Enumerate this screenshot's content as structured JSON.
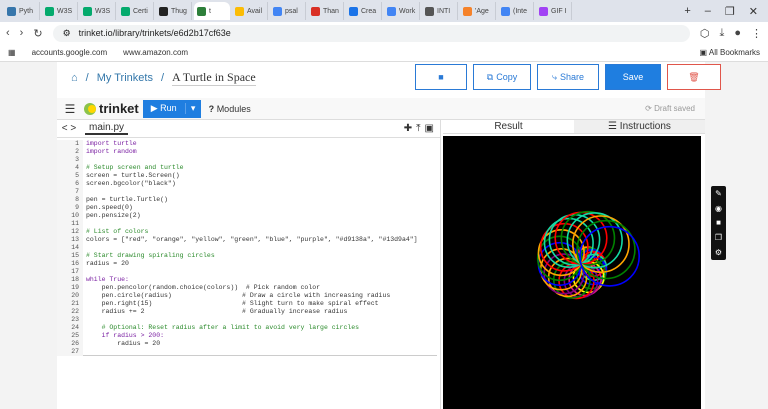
{
  "browser": {
    "tabs": [
      {
        "label": "Pyth",
        "color": "#3776ab"
      },
      {
        "label": "W3S",
        "color": "#04aa6d"
      },
      {
        "label": "W3S",
        "color": "#04aa6d"
      },
      {
        "label": "Certi",
        "color": "#04aa6d"
      },
      {
        "label": "Thug",
        "color": "#222"
      },
      {
        "label": "t",
        "color": "#2d7f3a",
        "active": true
      },
      {
        "label": "Avail",
        "color": "#fbbc05"
      },
      {
        "label": "psal",
        "color": "#4285f4"
      },
      {
        "label": "Than",
        "color": "#d93025"
      },
      {
        "label": "Crea",
        "color": "#1a73e8"
      },
      {
        "label": "Work",
        "color": "#4285f4"
      },
      {
        "label": "INTI",
        "color": "#555"
      },
      {
        "label": "'Age",
        "color": "#f5822a"
      },
      {
        "label": "(Inte",
        "color": "#4285f4"
      },
      {
        "label": "GIF I",
        "color": "#a142f4"
      }
    ],
    "url": "trinket.io/library/trinkets/e6d2b17cf63e",
    "bookmarks": [
      "accounts.google.com",
      "www.amazon.com"
    ],
    "all_bookmarks": "All Bookmarks"
  },
  "crumbs": {
    "trinkets": "My Trinkets",
    "current": "A Turtle in Space"
  },
  "buttons": {
    "copy": "Copy",
    "share": "Share",
    "save": "Save"
  },
  "toolbar": {
    "logo": "trinket",
    "run": "Run",
    "modules": "Modules",
    "draft": "Draft saved"
  },
  "editor": {
    "filename": "main.py",
    "lines": [
      "import turtle",
      "import random",
      "",
      "# Setup screen and turtle",
      "screen = turtle.Screen()",
      "screen.bgcolor(\"black\")",
      "",
      "pen = turtle.Turtle()",
      "pen.speed(0)",
      "pen.pensize(2)",
      "",
      "# List of colors",
      "colors = [\"red\", \"orange\", \"yellow\", \"green\", \"blue\", \"purple\", \"#d9138a\", \"#13d9a4\"]",
      "",
      "# Start drawing spiraling circles",
      "radius = 20",
      "",
      "while True:",
      "    pen.pencolor(random.choice(colors))  # Pick random color",
      "    pen.circle(radius)                  # Draw a circle with increasing radius",
      "    pen.right(15)                       # Slight turn to make spiral effect",
      "    radius += 2                         # Gradually increase radius",
      "",
      "    # Optional: Reset radius after a limit to avoid very large circles",
      "    if radius > 200:",
      "        radius = 20",
      ""
    ]
  },
  "result": {
    "tab_result": "Result",
    "tab_instructions": "Instructions"
  },
  "circle_colors": [
    "red",
    "orange",
    "yellow",
    "green",
    "blue",
    "purple",
    "#d9138a",
    "#13d9a4"
  ]
}
